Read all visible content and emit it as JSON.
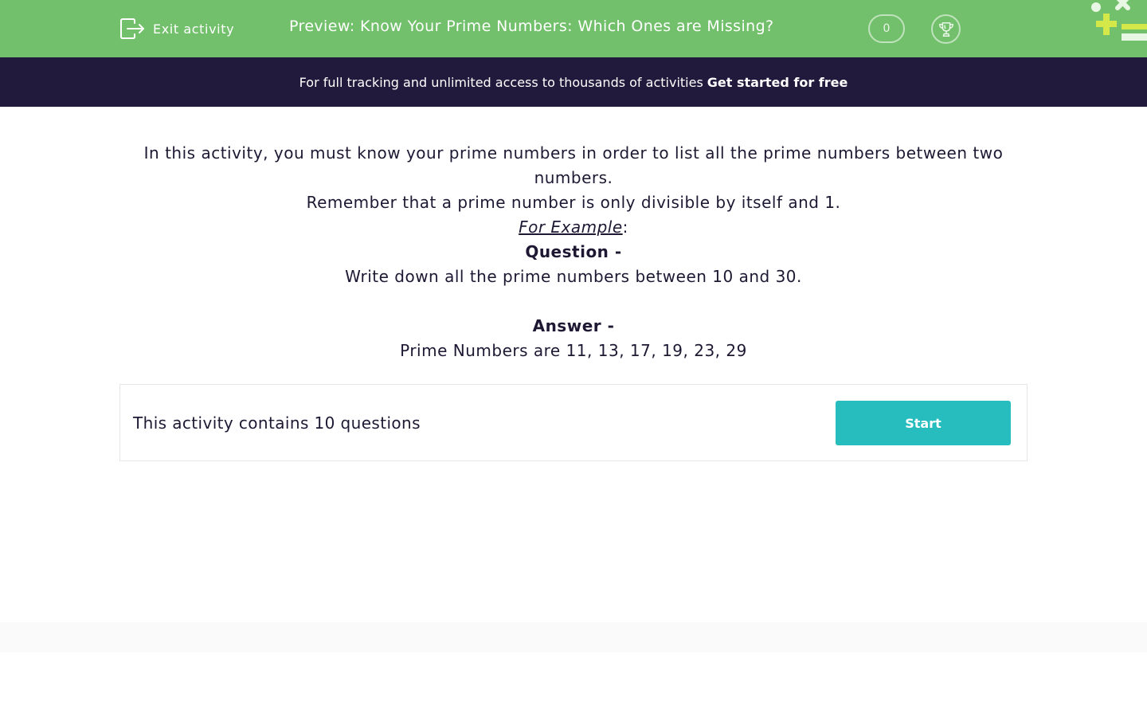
{
  "header": {
    "exit_label": "Exit activity",
    "title": "Preview: Know Your Prime Numbers: Which Ones are Missing?",
    "score": "0",
    "bg_color": "#72c06b"
  },
  "promo": {
    "text": "For full tracking and unlimited access to thousands of activities",
    "cta": "Get started for free",
    "bg_color": "#221a3c"
  },
  "intro": {
    "line1": "In this activity, you must know your prime numbers in order to list all the prime numbers between two numbers.",
    "line2": "Remember that a prime number is only divisible by itself and 1.",
    "example_label": "For Example",
    "example_suffix": ":",
    "question_heading": "Question -",
    "question_text": "Write down all the prime numbers between 10 and 30.",
    "answer_heading": "Answer -",
    "answer_text": "Prime Numbers are 11, 13, 17, 19, 23, 29"
  },
  "card": {
    "text": "This activity contains 10 questions",
    "start_label": "Start",
    "button_color": "#27bdbe"
  }
}
